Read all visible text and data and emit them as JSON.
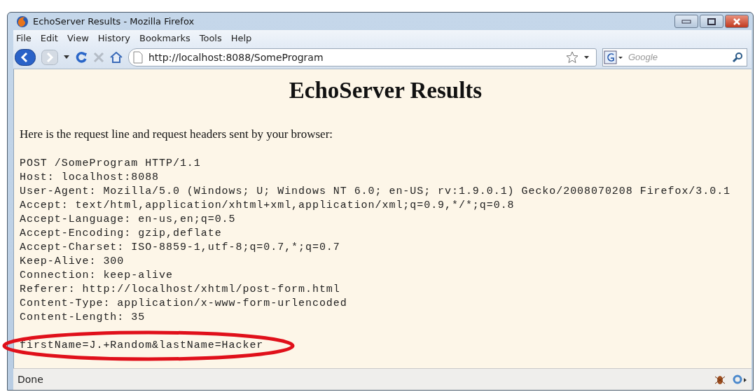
{
  "window": {
    "title": "EchoServer Results - Mozilla Firefox"
  },
  "menu": [
    "File",
    "Edit",
    "View",
    "History",
    "Bookmarks",
    "Tools",
    "Help"
  ],
  "navigation": {
    "url": "http://localhost:8088/SomeProgram",
    "search_placeholder": "Google"
  },
  "page": {
    "heading": "EchoServer Results",
    "intro": "Here is the request line and request headers sent by your browser:",
    "request_lines": [
      "POST /SomeProgram HTTP/1.1",
      "Host: localhost:8088",
      "User-Agent: Mozilla/5.0 (Windows; U; Windows NT 6.0; en-US; rv:1.9.0.1) Gecko/2008070208 Firefox/3.0.1",
      "Accept: text/html,application/xhtml+xml,application/xml;q=0.9,*/*;q=0.8",
      "Accept-Language: en-us,en;q=0.5",
      "Accept-Encoding: gzip,deflate",
      "Accept-Charset: ISO-8859-1,utf-8;q=0.7,*;q=0.7",
      "Keep-Alive: 300",
      "Connection: keep-alive",
      "Referer: http://localhost/xhtml/post-form.html",
      "Content-Type: application/x-www-form-urlencoded",
      "Content-Length: 35"
    ],
    "body_line": "firstName=J.+Random&lastName=Hacker"
  },
  "status_bar": {
    "text": "Done"
  }
}
